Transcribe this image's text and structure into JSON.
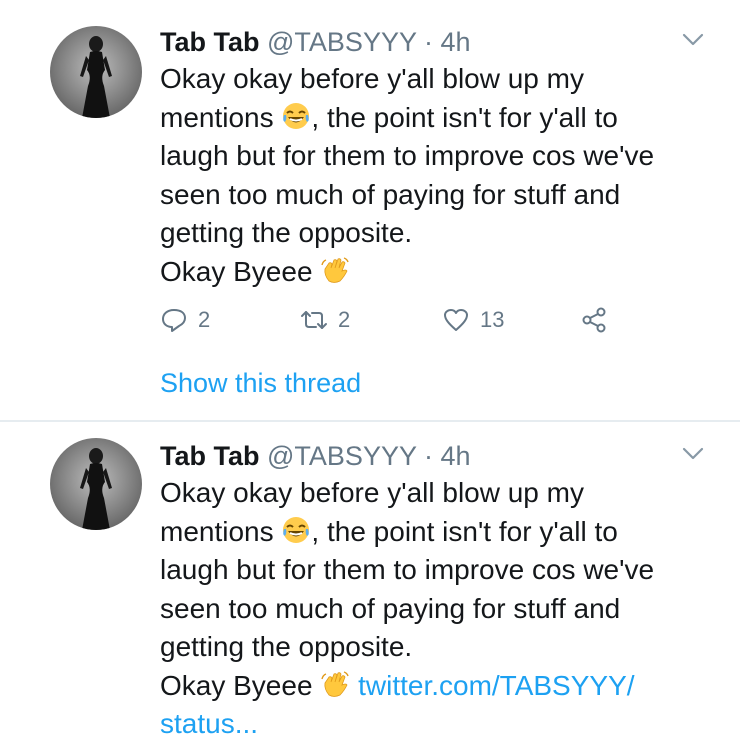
{
  "colors": {
    "link": "#1da1f2",
    "muted": "#657786",
    "text": "#14171a",
    "divider": "#e6ecf0"
  },
  "tweets": [
    {
      "name": "Tab Tab",
      "handle": "@TABSYYY",
      "separator": "·",
      "time": "4h",
      "lines": [
        "Okay okay before y'all blow up my",
        "mentions",
        ", the point isn't for y'all to",
        "laugh but for them to improve cos we've",
        "seen too much of paying for stuff and",
        "getting the opposite.",
        "Okay Byeee"
      ],
      "icons": {
        "laugh": "face-with-tears-of-joy-icon",
        "wave": "waving-hand-icon",
        "menu": "chevron-down-icon"
      },
      "actions": {
        "reply_count": "2",
        "retweet_count": "2",
        "like_count": "13"
      },
      "show_thread": "Show this thread"
    },
    {
      "name": "Tab Tab",
      "handle": "@TABSYYY",
      "separator": "·",
      "time": "4h",
      "lines": [
        "Okay okay before y'all blow up my",
        "mentions",
        ", the point isn't for y'all to",
        "laugh but for them to improve cos we've",
        "seen too much of paying for stuff and",
        "getting the opposite.",
        "Okay Byeee"
      ],
      "link_line_1": "twitter.com/TABSYYY/",
      "link_line_2": "status..."
    }
  ]
}
